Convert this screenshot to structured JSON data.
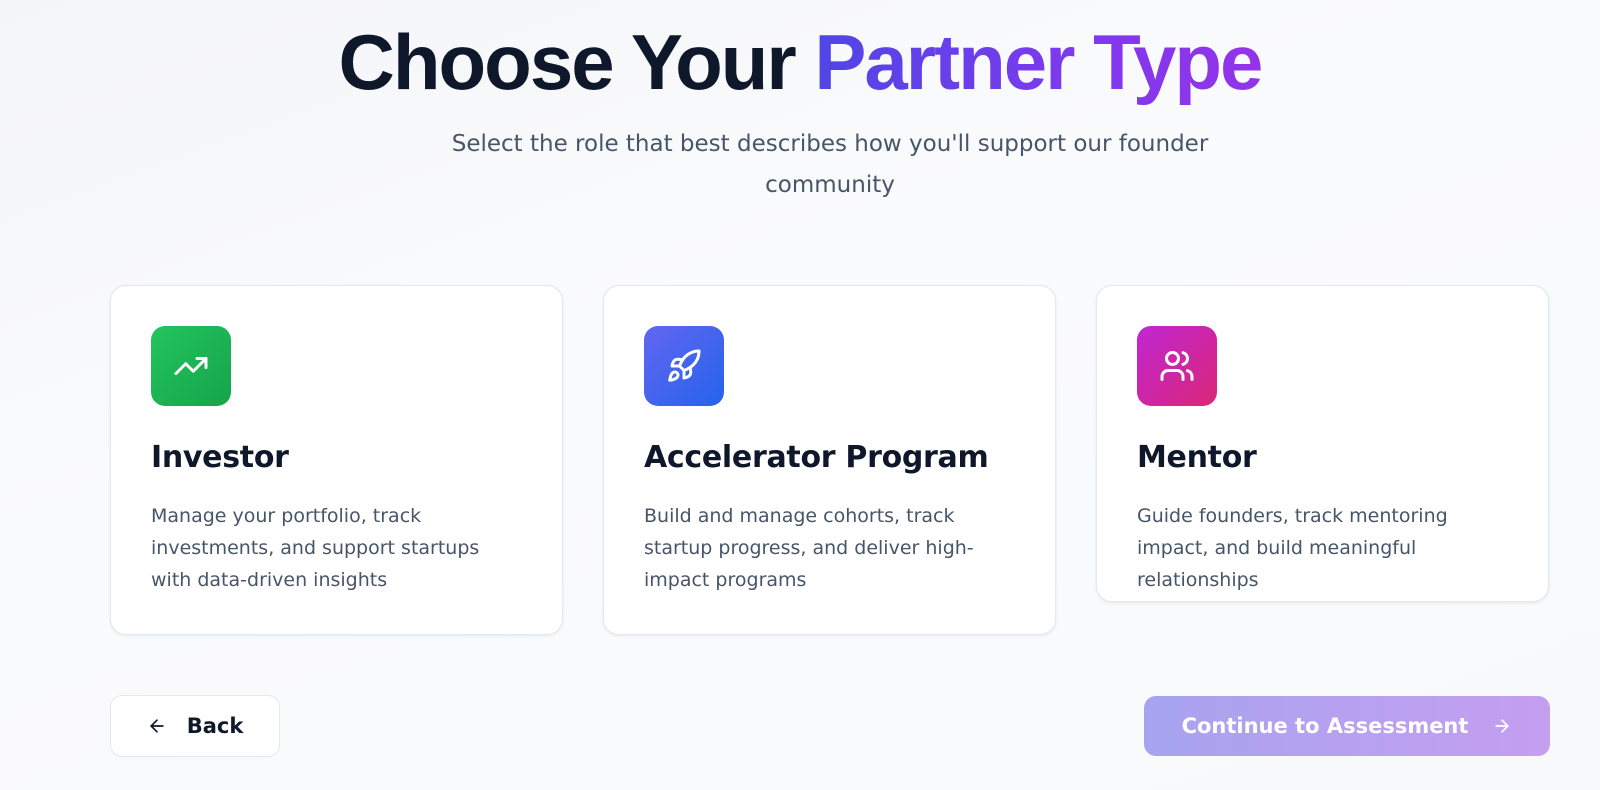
{
  "header": {
    "title_part1": "Choose Your ",
    "title_part2": "Partner Type",
    "subtitle": "Select the role that best describes how you'll support our founder community"
  },
  "cards": [
    {
      "title": "Investor",
      "description": "Manage your portfolio, track investments, and support startups with data-driven insights",
      "icon": "trending-up-icon",
      "gradient": [
        "#22c55e",
        "#16a34a"
      ]
    },
    {
      "title": "Accelerator Program",
      "description": "Build and manage cohorts, track startup progress, and deliver high-impact programs",
      "icon": "rocket-icon",
      "gradient": [
        "#6366f1",
        "#2563eb"
      ]
    },
    {
      "title": "Mentor",
      "description": "Guide founders, track mentoring impact, and build meaningful relationships",
      "icon": "users-icon",
      "gradient": [
        "#c026d3",
        "#db2777"
      ]
    }
  ],
  "footer": {
    "back_label": "Back",
    "continue_label": "Continue to Assessment"
  }
}
